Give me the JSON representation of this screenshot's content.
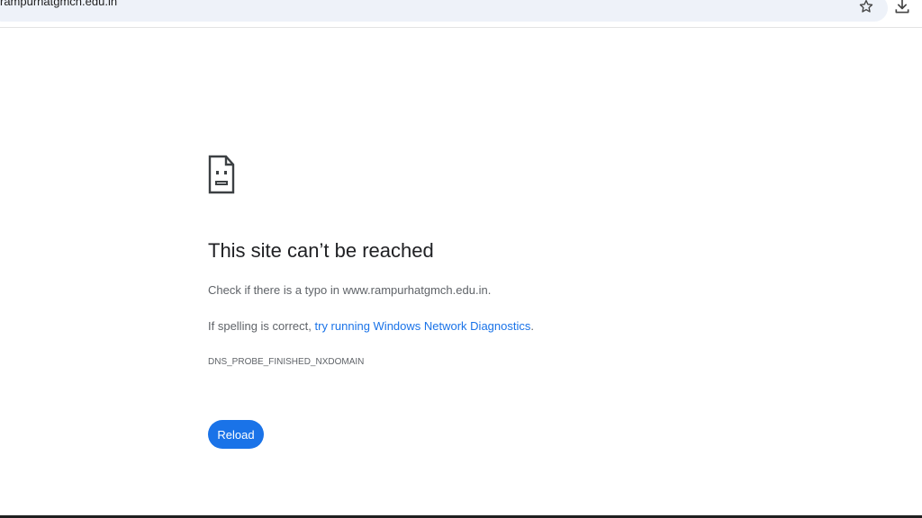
{
  "browser": {
    "url": "rampurhatgmch.edu.in",
    "icons": {
      "site_info": "site-info-icon",
      "bookmark": "star-icon",
      "download": "download-icon"
    }
  },
  "error_page": {
    "icon": "sad-document-icon",
    "title": "This site can’t be reached",
    "typo_message": "Check if there is a typo in www.rampurhatgmch.edu.in.",
    "spelling_prefix": "If spelling is correct, ",
    "diagnostics_link": "try running Windows Network Diagnostics",
    "spelling_suffix": ".",
    "error_code": "DNS_PROBE_FINISHED_NXDOMAIN",
    "reload_label": "Reload"
  },
  "colors": {
    "accent": "#1a73e8",
    "omnibox_bg": "#eef2f9",
    "title": "#202124",
    "body_text": "#5f6368"
  }
}
